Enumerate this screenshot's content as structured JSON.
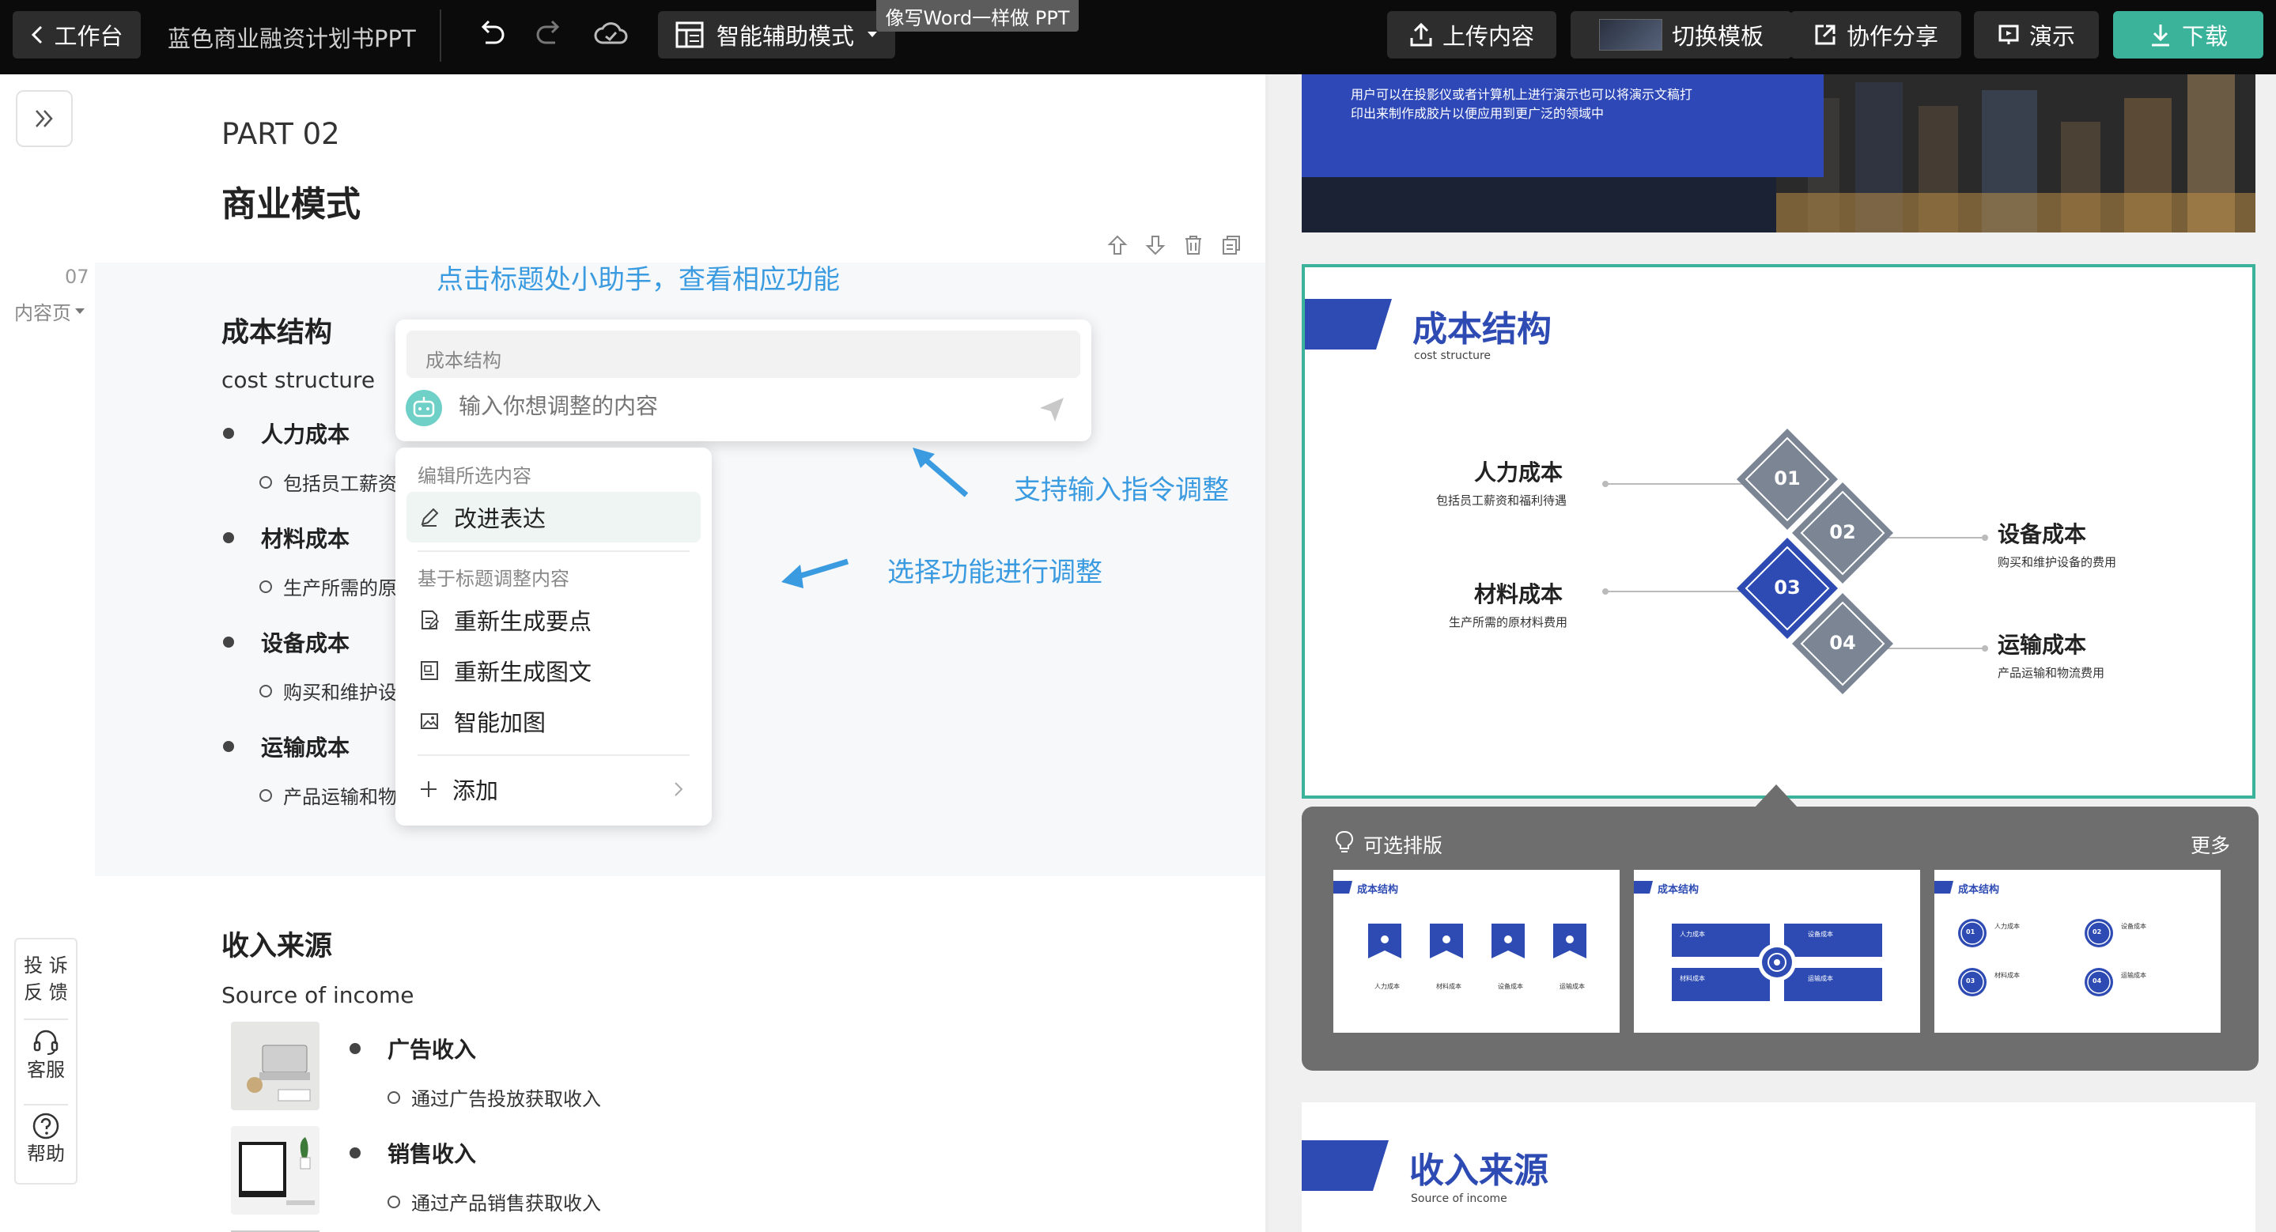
{
  "topbar": {
    "back_label": "工作台",
    "doc_title": "蓝色商业融资计划书PPT",
    "mode_label": "智能辅助模式",
    "tooltip": "像写Word一样做 PPT",
    "upload_label": "上传内容",
    "switch_template_label": "切换模板",
    "share_label": "协作分享",
    "present_label": "演示",
    "download_label": "下载"
  },
  "editor": {
    "part": "PART 02",
    "section": "商业模式",
    "page_number": "07",
    "page_type": "内容页",
    "hints": {
      "click_title": "点击标题处小助手，查看相应功能",
      "input_cmd": "支持输入指令调整",
      "select_func": "选择功能进行调整"
    },
    "cost": {
      "title": "成本结构",
      "subtitle": "cost structure",
      "items": [
        {
          "label": "人力成本",
          "detail": "包括员工薪资"
        },
        {
          "label": "材料成本",
          "detail": "生产所需的原"
        },
        {
          "label": "设备成本",
          "detail": "购买和维护设"
        },
        {
          "label": "运输成本",
          "detail": "产品运输和物"
        }
      ]
    },
    "ai_box": {
      "chip": "成本结构",
      "placeholder": "输入你想调整的内容"
    },
    "menu": {
      "group1": "编辑所选内容",
      "improve": "改进表达",
      "group2": "基于标题调整内容",
      "regen_points": "重新生成要点",
      "regen_text_img": "重新生成图文",
      "smart_image": "智能加图",
      "add": "添加"
    },
    "income": {
      "title": "收入来源",
      "subtitle": "Source of income",
      "items": [
        {
          "label": "广告收入",
          "detail": "通过广告投放获取收入"
        },
        {
          "label": "销售收入",
          "detail": "通过产品销售获取收入"
        }
      ]
    },
    "side": {
      "feedback_1": "投 诉",
      "feedback_2": "反 馈",
      "service": "客服",
      "help": "帮助"
    }
  },
  "preview": {
    "slide1_text_1": "用户可以在投影仪或者计算机上进行演示也可以将演示文稿打",
    "slide1_text_2": "印出来制作成胶片以便应用到更广泛的领域中",
    "slide2": {
      "title": "成本结构",
      "subtitle": "cost structure",
      "nodes": [
        {
          "num": "01",
          "title": "人力成本",
          "sub": "包括员工薪资和福利待遇"
        },
        {
          "num": "02",
          "title": "设备成本",
          "sub": "购买和维护设备的费用"
        },
        {
          "num": "03",
          "title": "材料成本",
          "sub": "生产所需的原材料费用"
        },
        {
          "num": "04",
          "title": "运输成本",
          "sub": "产品运输和物流费用"
        }
      ]
    },
    "layout_panel": {
      "title": "可选排版",
      "more": "更多",
      "card_title": "成本结构",
      "mini_labels": [
        "人力成本",
        "材料成本",
        "设备成本",
        "运输成本"
      ],
      "mini_nums": [
        "01",
        "02",
        "03",
        "04"
      ]
    },
    "slide3": {
      "title": "收入来源",
      "subtitle": "Source of income"
    }
  },
  "colors": {
    "accent": "#3bb39a",
    "brand_blue": "#2d4bb3",
    "hint_blue": "#3b9be0",
    "diamond_gray": "#7b8594"
  }
}
